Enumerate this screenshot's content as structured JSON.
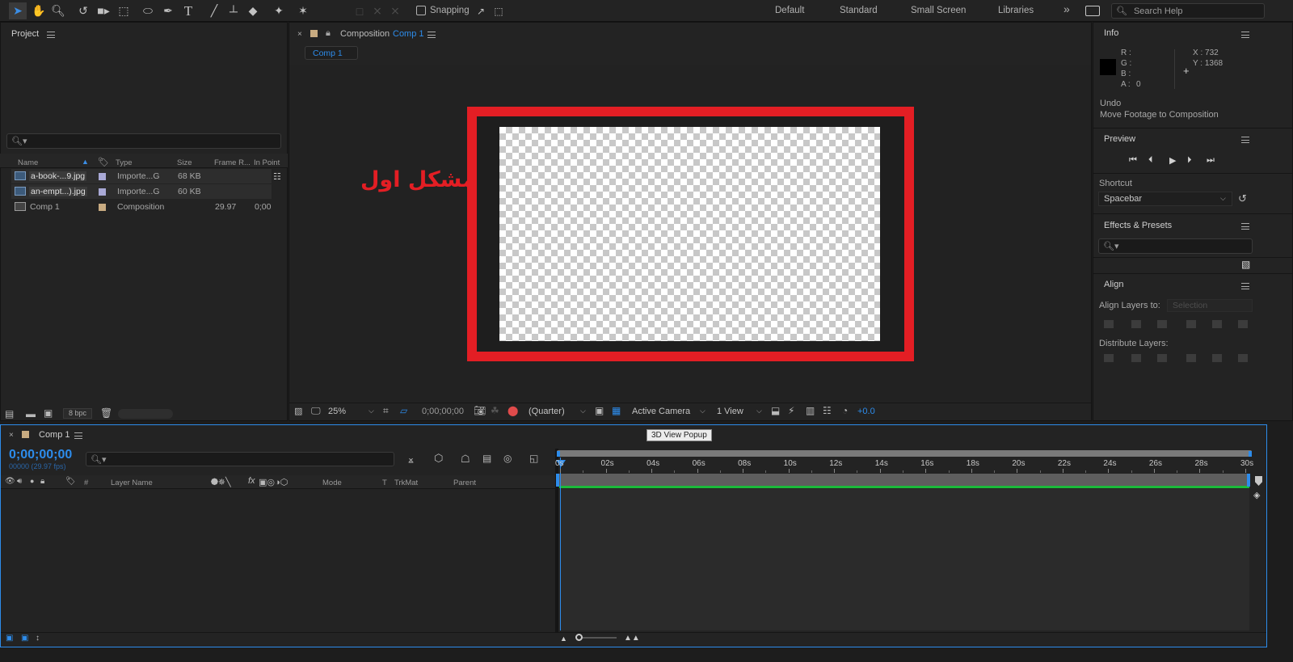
{
  "toolbar": {
    "snapping_label": "Snapping",
    "workspaces": [
      "Default",
      "Standard",
      "Small Screen",
      "Libraries"
    ],
    "overflow_glyph": "»",
    "search_placeholder": "Search Help"
  },
  "project": {
    "title": "Project",
    "columns": [
      "Name",
      "Type",
      "Size",
      "Frame R...",
      "In Point"
    ],
    "items": [
      {
        "name": "a-book-...9.jpg",
        "type": "Importe...G",
        "size": "68 KB",
        "frame_rate": "",
        "in_point": "",
        "kind": "image",
        "label_color": "#a9a9d6"
      },
      {
        "name": "an-empt...).jpg",
        "type": "Importe...G",
        "size": "60 KB",
        "frame_rate": "",
        "in_point": "",
        "kind": "image",
        "label_color": "#a9a9d6"
      },
      {
        "name": "Comp 1",
        "type": "Composition",
        "size": "",
        "frame_rate": "29.97",
        "in_point": "0;00",
        "kind": "composition",
        "label_color": "#c8ab81"
      }
    ],
    "bpc": "8 bpc"
  },
  "composition": {
    "tab_label": "Composition",
    "comp_name": "Comp 1",
    "flow_tab": "Comp 1",
    "annotation": "مشکل اول",
    "annotation_color": "#e31e24",
    "footer": {
      "zoom": "25%",
      "timecode": "0;00;00;00",
      "resolution": "(Quarter)",
      "camera": "Active Camera",
      "views": "1 View",
      "exposure": "+0.0"
    }
  },
  "info": {
    "title": "Info",
    "r": "R :",
    "g": "G :",
    "b": "B :",
    "a": "A :",
    "a_value": "0",
    "x": "X : 732",
    "y": "Y : 1368",
    "undo_label": "Undo",
    "undo_action": "Move Footage to Composition"
  },
  "preview": {
    "title": "Preview",
    "shortcut_label": "Shortcut",
    "shortcut_value": "Spacebar"
  },
  "effects": {
    "title": "Effects & Presets"
  },
  "align": {
    "title": "Align",
    "align_to_label": "Align Layers to:",
    "align_to_value": "Selection",
    "distribute_label": "Distribute Layers:"
  },
  "timeline": {
    "tab": "Comp 1",
    "timecode": "0;00;00;00",
    "frame_info": "00000 (29.97 fps)",
    "tooltip": "3D View Popup",
    "columns": [
      "#",
      "Layer Name",
      "Mode",
      "T",
      "TrkMat",
      "Parent"
    ],
    "ruler": [
      "0s",
      "02s",
      "04s",
      "06s",
      "08s",
      "10s",
      "12s",
      "14s",
      "16s",
      "18s",
      "20s",
      "22s",
      "24s",
      "26s",
      "28s",
      "30s"
    ],
    "accent": "#2d8ceb"
  },
  "icons": [
    "selection-tool",
    "hand-tool",
    "zoom-tool",
    "rotate-tool",
    "camera-tool",
    "pan-behind-tool",
    "ellipse-tool",
    "pen-tool",
    "type-tool",
    "brush-tool",
    "clone-stamp-tool",
    "eraser-tool",
    "roto-brush-tool",
    "puppet-pin-tool"
  ]
}
